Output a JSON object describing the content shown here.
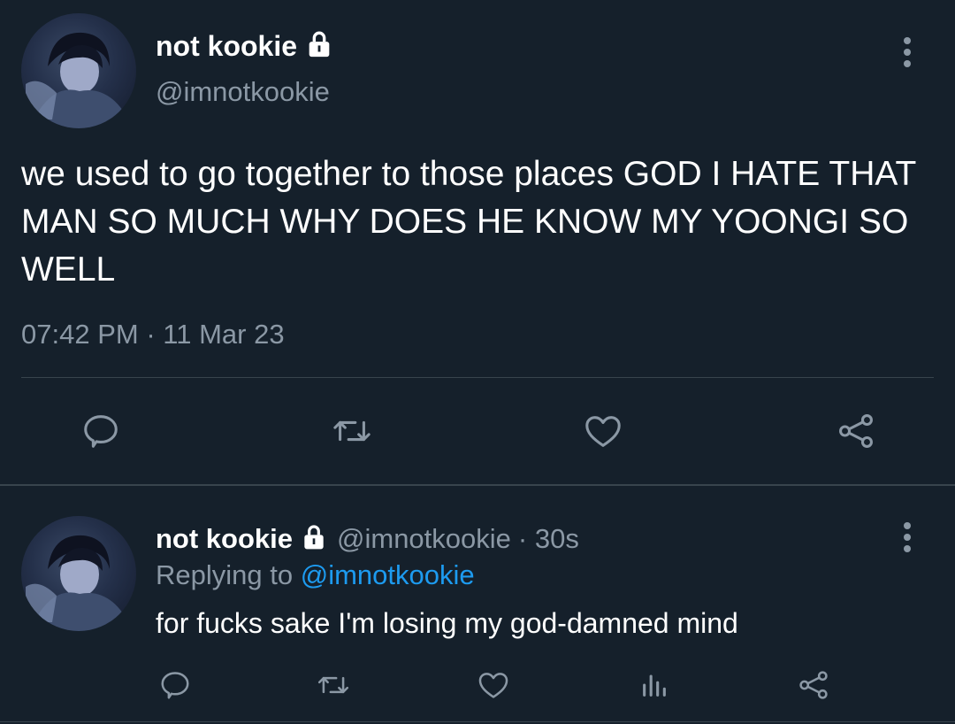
{
  "main_tweet": {
    "display_name": "not kookie",
    "handle": "@imnotkookie",
    "text": "we used to go together to those places GOD I HATE THAT MAN SO MUCH WHY DOES HE KNOW MY YOONGI SO WELL",
    "time": "07:42 PM",
    "separator": "·",
    "date": "11 Mar 23",
    "actions": [
      "reply-icon",
      "retweet-icon",
      "like-icon",
      "share-icon"
    ]
  },
  "reply_tweet": {
    "display_name": "not kookie",
    "handle": "@imnotkookie",
    "age": "· 30s",
    "replying_prefix": "Replying to",
    "replying_to": "@imnotkookie",
    "text": "for fucks sake I'm losing my god-damned mind",
    "actions": [
      "reply-icon",
      "retweet-icon",
      "like-icon",
      "analytics-icon",
      "share-icon"
    ]
  },
  "colors": {
    "background": "#15202b",
    "text": "#ffffff",
    "muted": "#8b98a5",
    "link": "#1d9bf0",
    "divider": "#38444d"
  }
}
